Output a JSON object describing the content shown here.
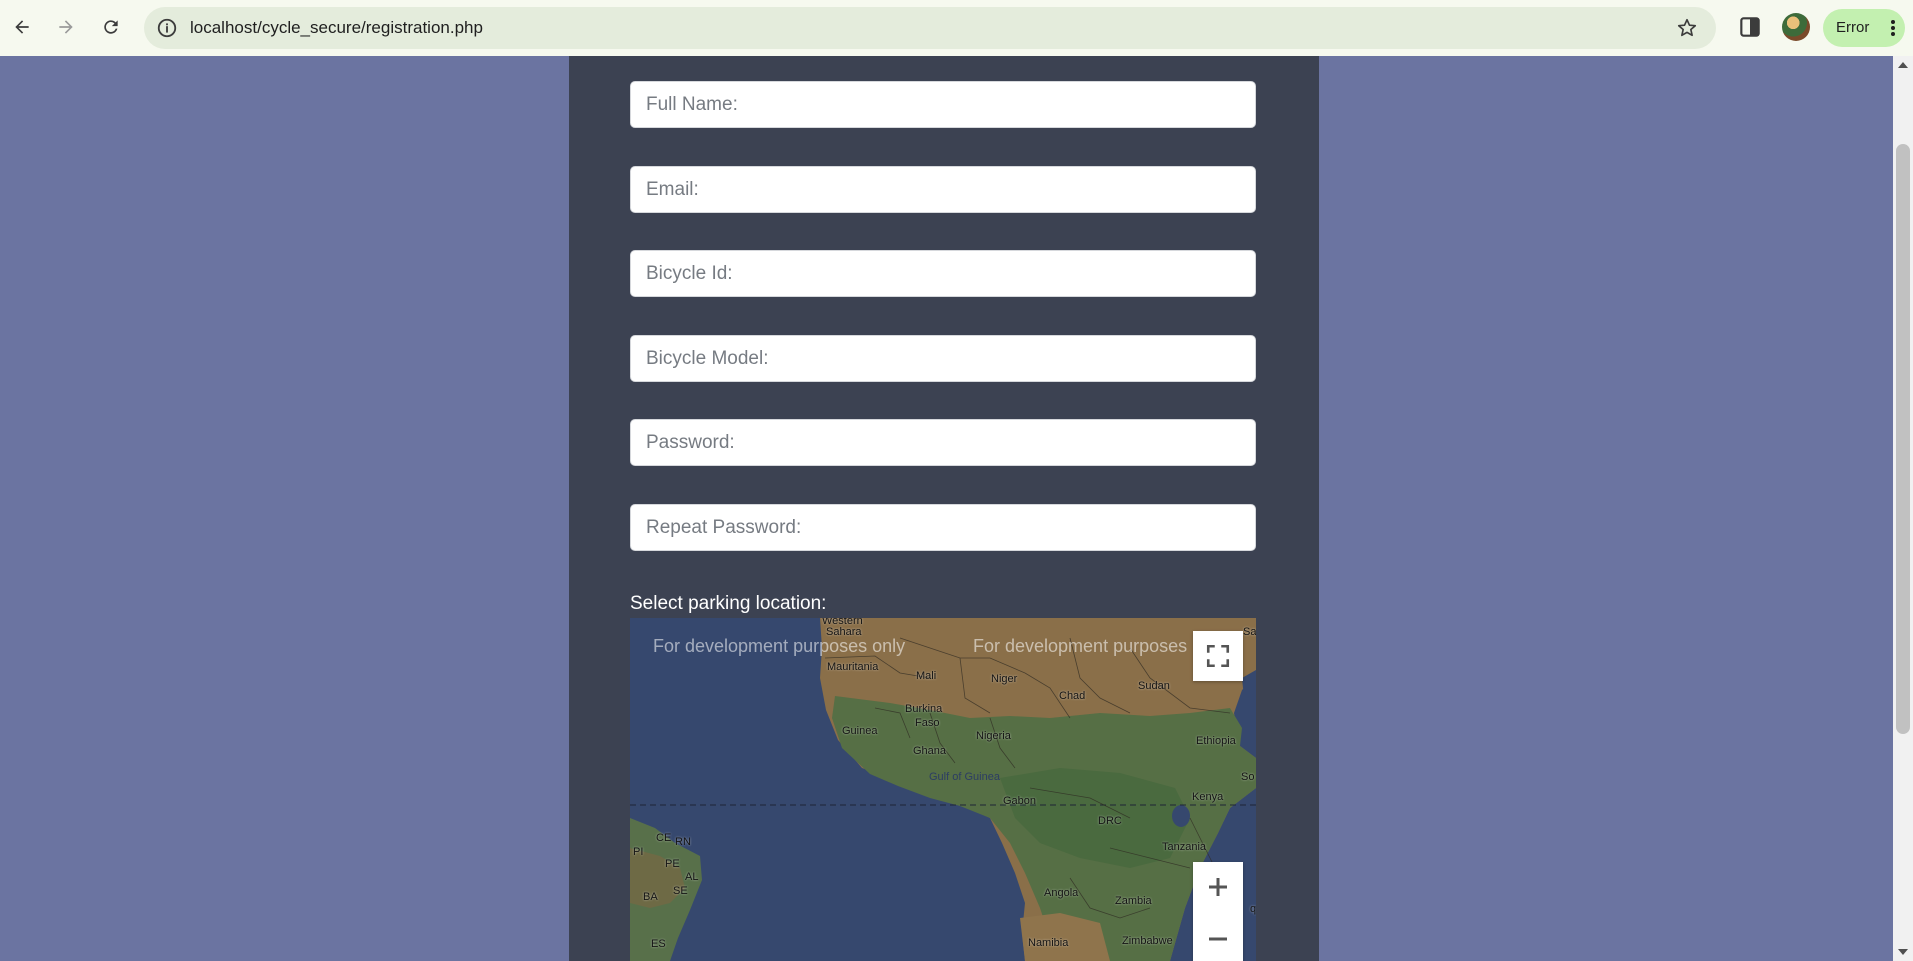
{
  "browser": {
    "url": "localhost/cycle_secure/registration.php",
    "status_label": "Error",
    "icons": [
      "back-arrow-icon",
      "forward-arrow-icon",
      "reload-icon",
      "site-info-icon",
      "bookmark-star-icon",
      "side-panel-icon",
      "profile-avatar",
      "kebab-menu-icon"
    ]
  },
  "form": {
    "fields": [
      {
        "name": "fullname",
        "placeholder": "Full Name:",
        "value": ""
      },
      {
        "name": "email",
        "placeholder": "Email:",
        "value": ""
      },
      {
        "name": "bicycle_id",
        "placeholder": "Bicycle Id:",
        "value": ""
      },
      {
        "name": "bicycle_model",
        "placeholder": "Bicycle Model:",
        "value": ""
      },
      {
        "name": "password",
        "placeholder": "Password:",
        "value": ""
      },
      {
        "name": "repeat_password",
        "placeholder": "Repeat Password:",
        "value": ""
      }
    ],
    "map_label": "Select parking location:"
  },
  "map": {
    "watermark": "For development purposes only",
    "watermark_cut": "For development purposes",
    "labels": {
      "western_sahara_top": "Western",
      "sahara": "Sahara",
      "mauritania": "Mauritania",
      "mali": "Mali",
      "niger": "Niger",
      "chad": "Chad",
      "sudan": "Sudan",
      "saudi_cut": "Saud",
      "burkina": "Burkina",
      "faso": "Faso",
      "guinea": "Guinea",
      "nigeria": "Nigeria",
      "ethiopia": "Ethiopia",
      "ghana": "Ghana",
      "gulf": "Gulf of Guinea",
      "somalia_cut": "So",
      "gabon": "Gabon",
      "kenya": "Kenya",
      "drc": "DRC",
      "tanzania": "Tanzania",
      "angola": "Angola",
      "zambia": "Zambia",
      "namibia": "Namibia",
      "zimbabwe": "Zimbabwe",
      "mozambique_cut": "q",
      "ce": "CE",
      "rn": "RN",
      "pi": "PI",
      "pe": "PE",
      "al": "AL",
      "se": "SE",
      "ba": "BA",
      "es": "ES"
    },
    "controls": [
      "fullscreen-button",
      "zoom-in-button",
      "zoom-out-button"
    ]
  },
  "colors": {
    "page_background": "#6b74a1",
    "panel_background": "#3c4252",
    "ocean": "#36486e",
    "land": "#8a6f49",
    "vegetation": "#4f6f44",
    "status_pill": "#c3f0b0"
  }
}
